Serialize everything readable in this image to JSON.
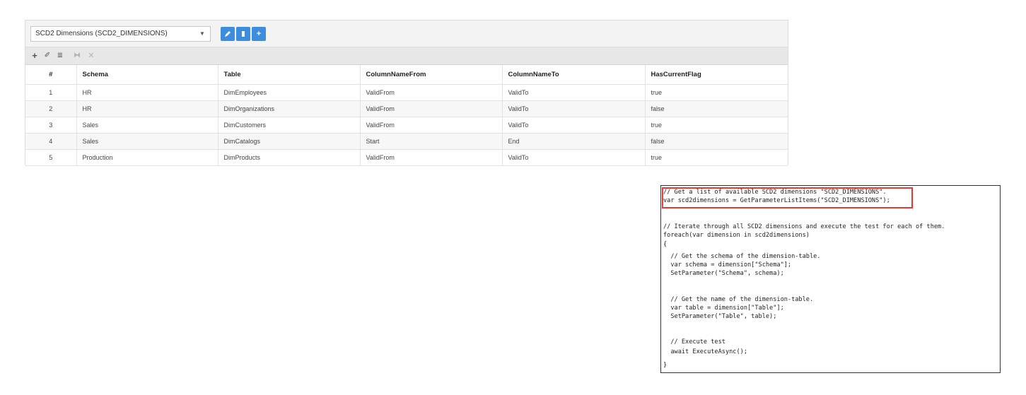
{
  "dimension_select": {
    "value": "SCD2 Dimensions (SCD2_DIMENSIONS)",
    "arrow_icon": "▼"
  },
  "action_buttons": {
    "edit_icon": "pencil-icon",
    "delete_icon": "trash-icon",
    "add_label": "+",
    "color": "#3c8dde"
  },
  "toolbar": {
    "add": "+",
    "edit": "✐",
    "delete": "≣",
    "save": "⧓",
    "cancel": "✕"
  },
  "grid": {
    "columns": [
      "#",
      "Schema",
      "Table",
      "ColumnNameFrom",
      "ColumnNameTo",
      "HasCurrentFlag"
    ],
    "rows": [
      [
        "1",
        "HR",
        "DimEmployees",
        "ValidFrom",
        "ValidTo",
        "true"
      ],
      [
        "2",
        "HR",
        "DimOrganizations",
        "ValidFrom",
        "ValidTo",
        "false"
      ],
      [
        "3",
        "Sales",
        "DimCustomers",
        "ValidFrom",
        "ValidTo",
        "true"
      ],
      [
        "4",
        "Sales",
        "DimCatalogs",
        "Start",
        "End",
        "false"
      ],
      [
        "5",
        "Production",
        "DimProducts",
        "ValidFrom",
        "ValidTo",
        "true"
      ]
    ]
  },
  "code": {
    "highlight_color": "#e53935",
    "lines": [
      "// Get a list of available SCD2 dimensions \"SCD2_DIMENSIONS\".",
      "var scd2dimensions = GetParameterListItems(\"SCD2_DIMENSIONS\");",
      "",
      "// Iterate through all SCD2 dimensions and execute the test for each of them.",
      "foreach(var dimension in scd2dimensions)",
      "{",
      "  // Get the schema of the dimension-table.",
      "  var schema = dimension[\"Schema\"];",
      "  SetParameter(\"Schema\", schema);",
      "",
      "  // Get the name of the dimension-table.",
      "  var table = dimension[\"Table\"];",
      "  SetParameter(\"Table\", table);",
      "",
      "  // Execute test",
      "  await ExecuteAsync();",
      "}"
    ]
  }
}
